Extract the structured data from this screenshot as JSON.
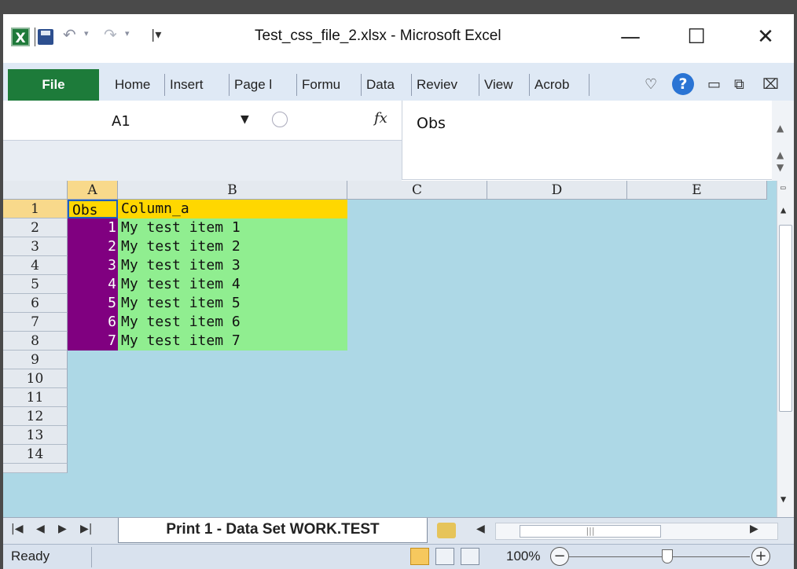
{
  "window": {
    "title": "Test_css_file_2.xlsx - Microsoft Excel",
    "app_icon": "X",
    "controls": {
      "minimize": "—",
      "maximize": "☐",
      "close": "✕"
    }
  },
  "qat": {
    "undo_glyph": "↶",
    "redo_glyph": "↷",
    "more_glyph": "|▾"
  },
  "ribbon": {
    "file_label": "File",
    "tabs": [
      "Home",
      "Insert",
      "Page l",
      "Formu",
      "Data",
      "Reviev",
      "View",
      "Acrob"
    ],
    "help_glyph": "?"
  },
  "formula_bar": {
    "name_box": "A1",
    "fx": "fx",
    "content": "Obs"
  },
  "sheet": {
    "columns": [
      "A",
      "B",
      "C",
      "D",
      "E"
    ],
    "rows": [
      "1",
      "2",
      "3",
      "4",
      "5",
      "6",
      "7",
      "8",
      "9",
      "10",
      "11",
      "12",
      "13",
      "14"
    ],
    "header_row": {
      "obs": "Obs",
      "col_a": "Column_a"
    },
    "data": [
      {
        "obs": "1",
        "col_a": "My test item 1"
      },
      {
        "obs": "2",
        "col_a": "My test item 2"
      },
      {
        "obs": "3",
        "col_a": "My test item 3"
      },
      {
        "obs": "4",
        "col_a": "My test item 4"
      },
      {
        "obs": "5",
        "col_a": "My test item 5"
      },
      {
        "obs": "6",
        "col_a": "My test item 6"
      },
      {
        "obs": "7",
        "col_a": "My test item 7"
      }
    ],
    "colors": {
      "background": "#add8e6",
      "header_fill": "#ffd700",
      "obs_fill": "#800080",
      "obs_text": "#ffffff",
      "data_fill": "#90ee90",
      "selection_header": "#f8d98b"
    }
  },
  "sheet_tabs": {
    "active": "Print 1 - Data Set WORK.TEST",
    "nav": [
      "|◀",
      "◀",
      "▶",
      "▶|"
    ]
  },
  "status": {
    "ready": "Ready",
    "zoom": "100%",
    "zoom_minus": "−",
    "zoom_plus": "+"
  }
}
